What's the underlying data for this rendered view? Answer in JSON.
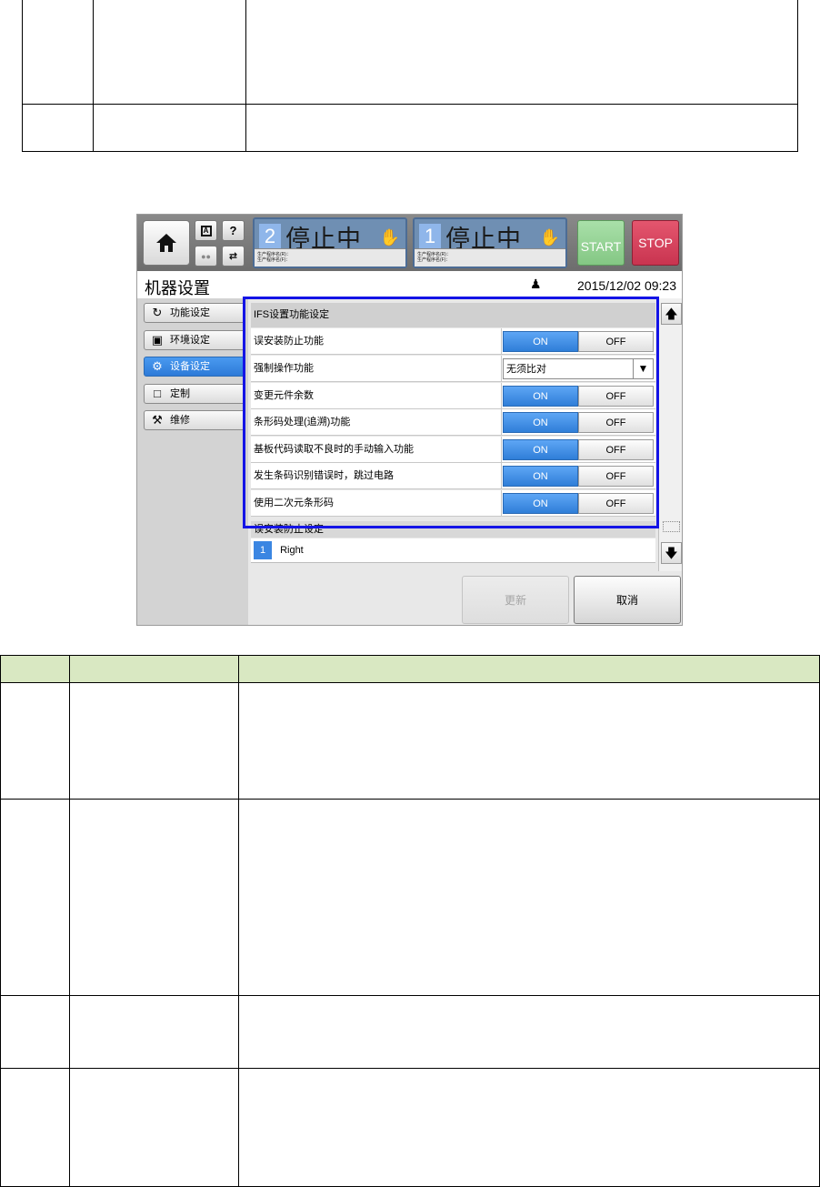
{
  "header": {
    "lanes": [
      {
        "number": "2",
        "status": "停止中",
        "info_line1": "生产程序名(R)：",
        "info_line2": "生产程序名(F)："
      },
      {
        "number": "1",
        "status": "停止中",
        "info_line1": "生产程序名(R)：",
        "info_line2": "生产程序名(F)："
      }
    ],
    "help_label": "?",
    "start_label": "START",
    "stop_label": "STOP"
  },
  "titlebar": {
    "title": "机器设置",
    "datetime": "2015/12/02 09:23"
  },
  "sidebar": {
    "items": [
      {
        "label": "功能设定",
        "icon": "function-icon",
        "active": false
      },
      {
        "label": "环境设定",
        "icon": "monitor-icon",
        "active": false
      },
      {
        "label": "设备设定",
        "icon": "equipment-icon",
        "active": true
      },
      {
        "label": "定制",
        "icon": "custom-icon",
        "active": false
      },
      {
        "label": "维修",
        "icon": "maintenance-icon",
        "active": false
      }
    ]
  },
  "panel": {
    "heading": "IFS设置功能设定",
    "rows": [
      {
        "label": "误安装防止功能",
        "type": "toggle",
        "on": "ON",
        "off": "OFF"
      },
      {
        "label": "强制操作功能",
        "type": "select",
        "value": "无须比对"
      },
      {
        "label": "变更元件余数",
        "type": "toggle",
        "on": "ON",
        "off": "OFF"
      },
      {
        "label": "条形码处理(追溯)功能",
        "type": "toggle",
        "on": "ON",
        "off": "OFF"
      },
      {
        "label": "基板代码读取不良时的手动输入功能",
        "type": "toggle",
        "on": "ON",
        "off": "OFF"
      },
      {
        "label": "发生条码识别错误时，跳过电路",
        "type": "toggle",
        "on": "ON",
        "off": "OFF"
      },
      {
        "label": "使用二次元条形码",
        "type": "toggle",
        "on": "ON",
        "off": "OFF"
      }
    ],
    "sub_heading": "误安装防止设定",
    "sub_row": {
      "number": "1",
      "label": "Right"
    },
    "update_label": "更新",
    "cancel_label": "取消"
  },
  "colors": {
    "accent_blue": "#2f7ed8",
    "highlight_frame": "#1414e6",
    "start_green": "#84c784",
    "stop_red": "#c93450",
    "table_header_green": "#d9e8c2"
  }
}
